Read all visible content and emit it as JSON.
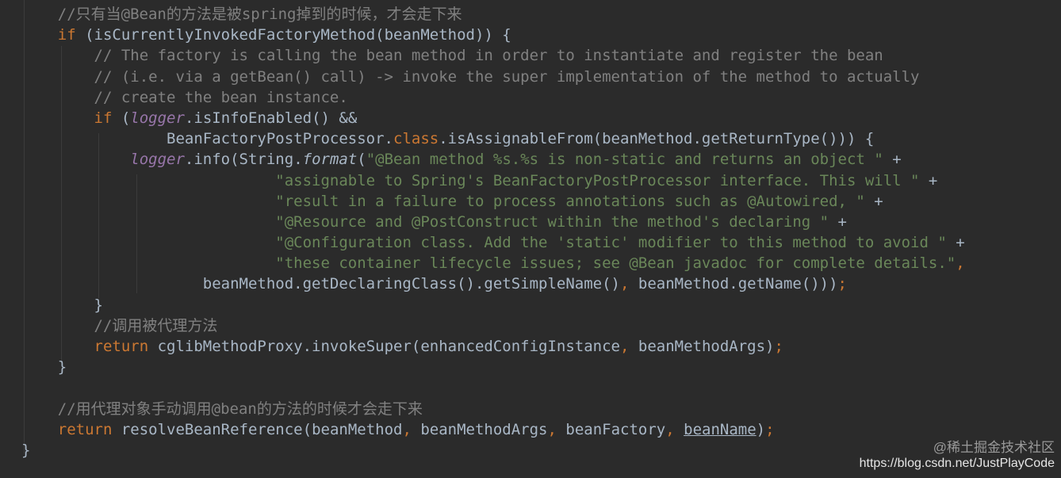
{
  "editor": {
    "language": "java",
    "theme_colors": {
      "background": "#2b2b2b",
      "plain": "#a9b7c6",
      "comment": "#808080",
      "keyword": "#cc7832",
      "string": "#6a8759",
      "static_field": "#9876aa",
      "annotation": "#bbb529"
    },
    "lines": [
      [
        {
          "t": "    //只有当@Bean的方法是被spring掉到的时候，才会走下来",
          "c": "comment"
        }
      ],
      [
        {
          "t": "    ",
          "c": "plain"
        },
        {
          "t": "if",
          "c": "keyword"
        },
        {
          "t": " (isCurrentlyInvokedFactoryMethod(beanMethod)) {",
          "c": "plain"
        }
      ],
      [
        {
          "t": "        // The factory is calling the bean method in order to instantiate and register the bean",
          "c": "comment"
        }
      ],
      [
        {
          "t": "        // (i.e. via a getBean() call) -> invoke the super implementation of the method to actually",
          "c": "comment"
        }
      ],
      [
        {
          "t": "        // create the bean instance.",
          "c": "comment"
        }
      ],
      [
        {
          "t": "        ",
          "c": "plain"
        },
        {
          "t": "if",
          "c": "keyword"
        },
        {
          "t": " (",
          "c": "plain"
        },
        {
          "t": "logger",
          "c": "static"
        },
        {
          "t": ".isInfoEnabled() &&",
          "c": "plain"
        }
      ],
      [
        {
          "t": "                BeanFactoryPostProcessor.",
          "c": "plain"
        },
        {
          "t": "class",
          "c": "keyword"
        },
        {
          "t": ".isAssignableFrom(beanMethod.getReturnType())) {",
          "c": "plain"
        }
      ],
      [
        {
          "t": "            ",
          "c": "plain"
        },
        {
          "t": "logger",
          "c": "static"
        },
        {
          "t": ".info(String.",
          "c": "plain"
        },
        {
          "t": "format",
          "c": "italic"
        },
        {
          "t": "(",
          "c": "plain"
        },
        {
          "t": "\"@Bean method %s.%s is non-static and returns an object \"",
          "c": "string"
        },
        {
          "t": " +",
          "c": "plain"
        }
      ],
      [
        {
          "t": "                            ",
          "c": "plain"
        },
        {
          "t": "\"assignable to Spring's BeanFactoryPostProcessor interface. This will \"",
          "c": "string"
        },
        {
          "t": " +",
          "c": "plain"
        }
      ],
      [
        {
          "t": "                            ",
          "c": "plain"
        },
        {
          "t": "\"result in a failure to process annotations such as @Autowired, \"",
          "c": "string"
        },
        {
          "t": " +",
          "c": "plain"
        }
      ],
      [
        {
          "t": "                            ",
          "c": "plain"
        },
        {
          "t": "\"@Resource and @PostConstruct within the method's declaring \"",
          "c": "string"
        },
        {
          "t": " +",
          "c": "plain"
        }
      ],
      [
        {
          "t": "                            ",
          "c": "plain"
        },
        {
          "t": "\"@Configuration class. Add the 'static' modifier to this method to avoid \"",
          "c": "string"
        },
        {
          "t": " +",
          "c": "plain"
        }
      ],
      [
        {
          "t": "                            ",
          "c": "plain"
        },
        {
          "t": "\"these container lifecycle issues; see @Bean javadoc for complete details.\"",
          "c": "string"
        },
        {
          "t": ",",
          "c": "keyword"
        }
      ],
      [
        {
          "t": "                    beanMethod.getDeclaringClass().getSimpleName()",
          "c": "plain"
        },
        {
          "t": ",",
          "c": "keyword"
        },
        {
          "t": " beanMethod.getName()))",
          "c": "plain"
        },
        {
          "t": ";",
          "c": "keyword"
        }
      ],
      [
        {
          "t": "        }",
          "c": "plain"
        }
      ],
      [
        {
          "t": "        //调用被代理方法",
          "c": "comment"
        }
      ],
      [
        {
          "t": "        ",
          "c": "plain"
        },
        {
          "t": "return",
          "c": "keyword"
        },
        {
          "t": " cglibMethodProxy.invokeSuper(enhancedConfigInstance",
          "c": "plain"
        },
        {
          "t": ",",
          "c": "keyword"
        },
        {
          "t": " beanMethodArgs)",
          "c": "plain"
        },
        {
          "t": ";",
          "c": "keyword"
        }
      ],
      [
        {
          "t": "    }",
          "c": "plain"
        }
      ],
      [
        {
          "t": "",
          "c": "plain"
        }
      ],
      [
        {
          "t": "    //用代理对象手动调用@bean的方法的时候才会走下来",
          "c": "comment"
        }
      ],
      [
        {
          "t": "    ",
          "c": "plain"
        },
        {
          "t": "return",
          "c": "keyword"
        },
        {
          "t": " resolveBeanReference(beanMethod",
          "c": "plain"
        },
        {
          "t": ",",
          "c": "keyword"
        },
        {
          "t": " beanMethodArgs",
          "c": "plain"
        },
        {
          "t": ",",
          "c": "keyword"
        },
        {
          "t": " beanFactory",
          "c": "plain"
        },
        {
          "t": ",",
          "c": "keyword"
        },
        {
          "t": " ",
          "c": "plain"
        },
        {
          "t": "beanName",
          "c": "under"
        },
        {
          "t": ")",
          "c": "plain"
        },
        {
          "t": ";",
          "c": "keyword"
        }
      ],
      [
        {
          "t": "}",
          "c": "plain"
        }
      ]
    ]
  },
  "watermark": {
    "line1": "@稀土掘金技术社区",
    "line2": "https://blog.csdn.net/JustPlayCode"
  }
}
